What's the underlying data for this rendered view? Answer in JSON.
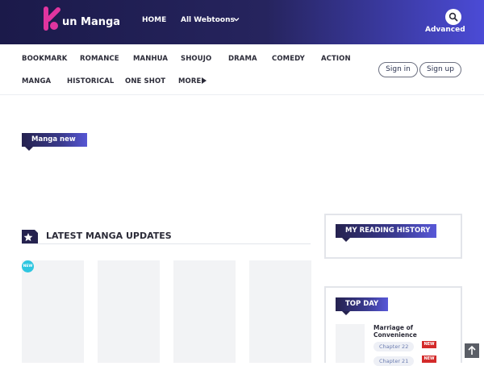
{
  "header": {
    "logo_text": "un Manga",
    "nav": {
      "home": "HOME",
      "webtoons": "All Webtoons"
    },
    "advanced": "Advanced",
    "colors": {
      "gradient_start": "#1b1a4a",
      "gradient_end": "#4b4bd6",
      "logo_pink": "#e0359f"
    }
  },
  "categories": {
    "row1": [
      "BOOKMARK",
      "ROMANCE",
      "MANHUA",
      "SHOUJO",
      "DRAMA",
      "COMEDY",
      "ACTION"
    ],
    "row2": [
      "MANGA",
      "HISTORICAL",
      "ONE SHOT",
      "MORE"
    ]
  },
  "auth": {
    "signin": "Sign in",
    "signup": "Sign up"
  },
  "manga_new": {
    "label": "Manga new"
  },
  "latest": {
    "title": "LATEST MANGA UPDATES",
    "new_badge": "NEW"
  },
  "sidebar": {
    "history_title": "MY READING HISTORY",
    "top_day_title": "TOP DAY",
    "top_day_items": [
      {
        "series": "Marriage of Convenience",
        "chapters": [
          {
            "label": "Chapter 22",
            "badge": "NEW"
          },
          {
            "label": "Chapter 21",
            "badge": "NEW"
          }
        ]
      }
    ]
  },
  "icons": {
    "search": "search-icon",
    "chevron": "chevron-down-icon",
    "more": "caret-right-icon",
    "star": "star-icon",
    "to_top": "arrow-up-icon"
  }
}
